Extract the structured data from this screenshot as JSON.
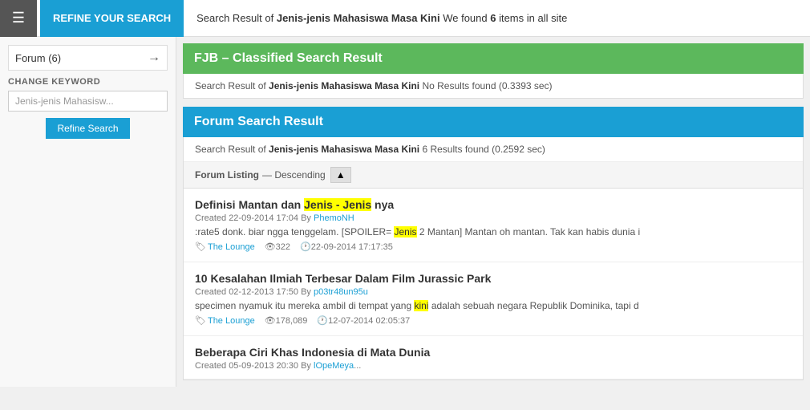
{
  "topbar": {
    "hamburger_icon": "☰",
    "refine_label": "REFINE YOUR SEARCH",
    "search_result_prefix": "Search Result of ",
    "search_keyword": "Jenis-jenis Mahasiswa Masa Kini",
    "search_result_suffix": " We found ",
    "search_count": "6",
    "search_result_end": " items in all site"
  },
  "sidebar": {
    "forum_label": "Forum",
    "forum_count": "(6)",
    "arrow": "→",
    "change_keyword_label": "CHANGE KEYWORD",
    "keyword_value": "Jenis-jenis Mahasisw...",
    "keyword_placeholder": "Jenis-jenis Mahasisw...",
    "refine_button_label": "Refine Search"
  },
  "fjb_section": {
    "header": "FJB – Classified Search Result",
    "result_prefix": "Search Result of ",
    "result_keyword": "Jenis-jenis Mahasiswa Masa Kini",
    "result_suffix": " No Results found (0.3393 sec)"
  },
  "forum_section": {
    "header": "Forum Search Result",
    "result_prefix": "Search Result of ",
    "result_keyword": "Jenis-jenis Mahasiswa Masa Kini",
    "result_suffix": " 6 Results found (0.2592 sec)",
    "listing_label": "Forum Listing",
    "listing_order": "— Descending",
    "sort_icon": "▲",
    "items": [
      {
        "title_before": "Definisi Mantan dan ",
        "title_highlight": "Jenis - Jenis",
        "title_after": " nya",
        "meta": "Created 22-09-2014 17:04 By PhemoNH",
        "meta_link": "PhemoNH",
        "preview_before": ":rate5 donk. biar ngga tenggelam. [SPOILER= ",
        "preview_highlight": "Jenis",
        "preview_after": " 2 Mantan] Mantan oh mantan. Tak kan habis dunia i",
        "tag": "The Lounge",
        "views": "322",
        "date": "22-09-2014 17:17:35"
      },
      {
        "title_before": "10 Kesalahan Ilmiah Terbesar Dalam Film Jurassic Park",
        "title_highlight": "",
        "title_after": "",
        "meta": "Created 02-12-2013 17:50 By p03tr48un95u",
        "meta_link": "p03tr48un95u",
        "preview_before": "specimen nyamuk itu mereka ambil di tempat yang ",
        "preview_highlight": "kini",
        "preview_after": " adalah sebuah negara Republik Dominika, tapi d",
        "tag": "The Lounge",
        "views": "178,089",
        "date": "12-07-2014 02:05:37"
      },
      {
        "title_before": "Beberapa Ciri Khas Indonesia di Mata Dunia",
        "title_highlight": "",
        "title_after": "",
        "meta": "Created 05-09-2013 20:30 By lOpeMeya...",
        "meta_link": "lOpeMeya",
        "preview_before": "",
        "preview_highlight": "",
        "preview_after": "",
        "tag": "",
        "views": "",
        "date": ""
      }
    ]
  }
}
